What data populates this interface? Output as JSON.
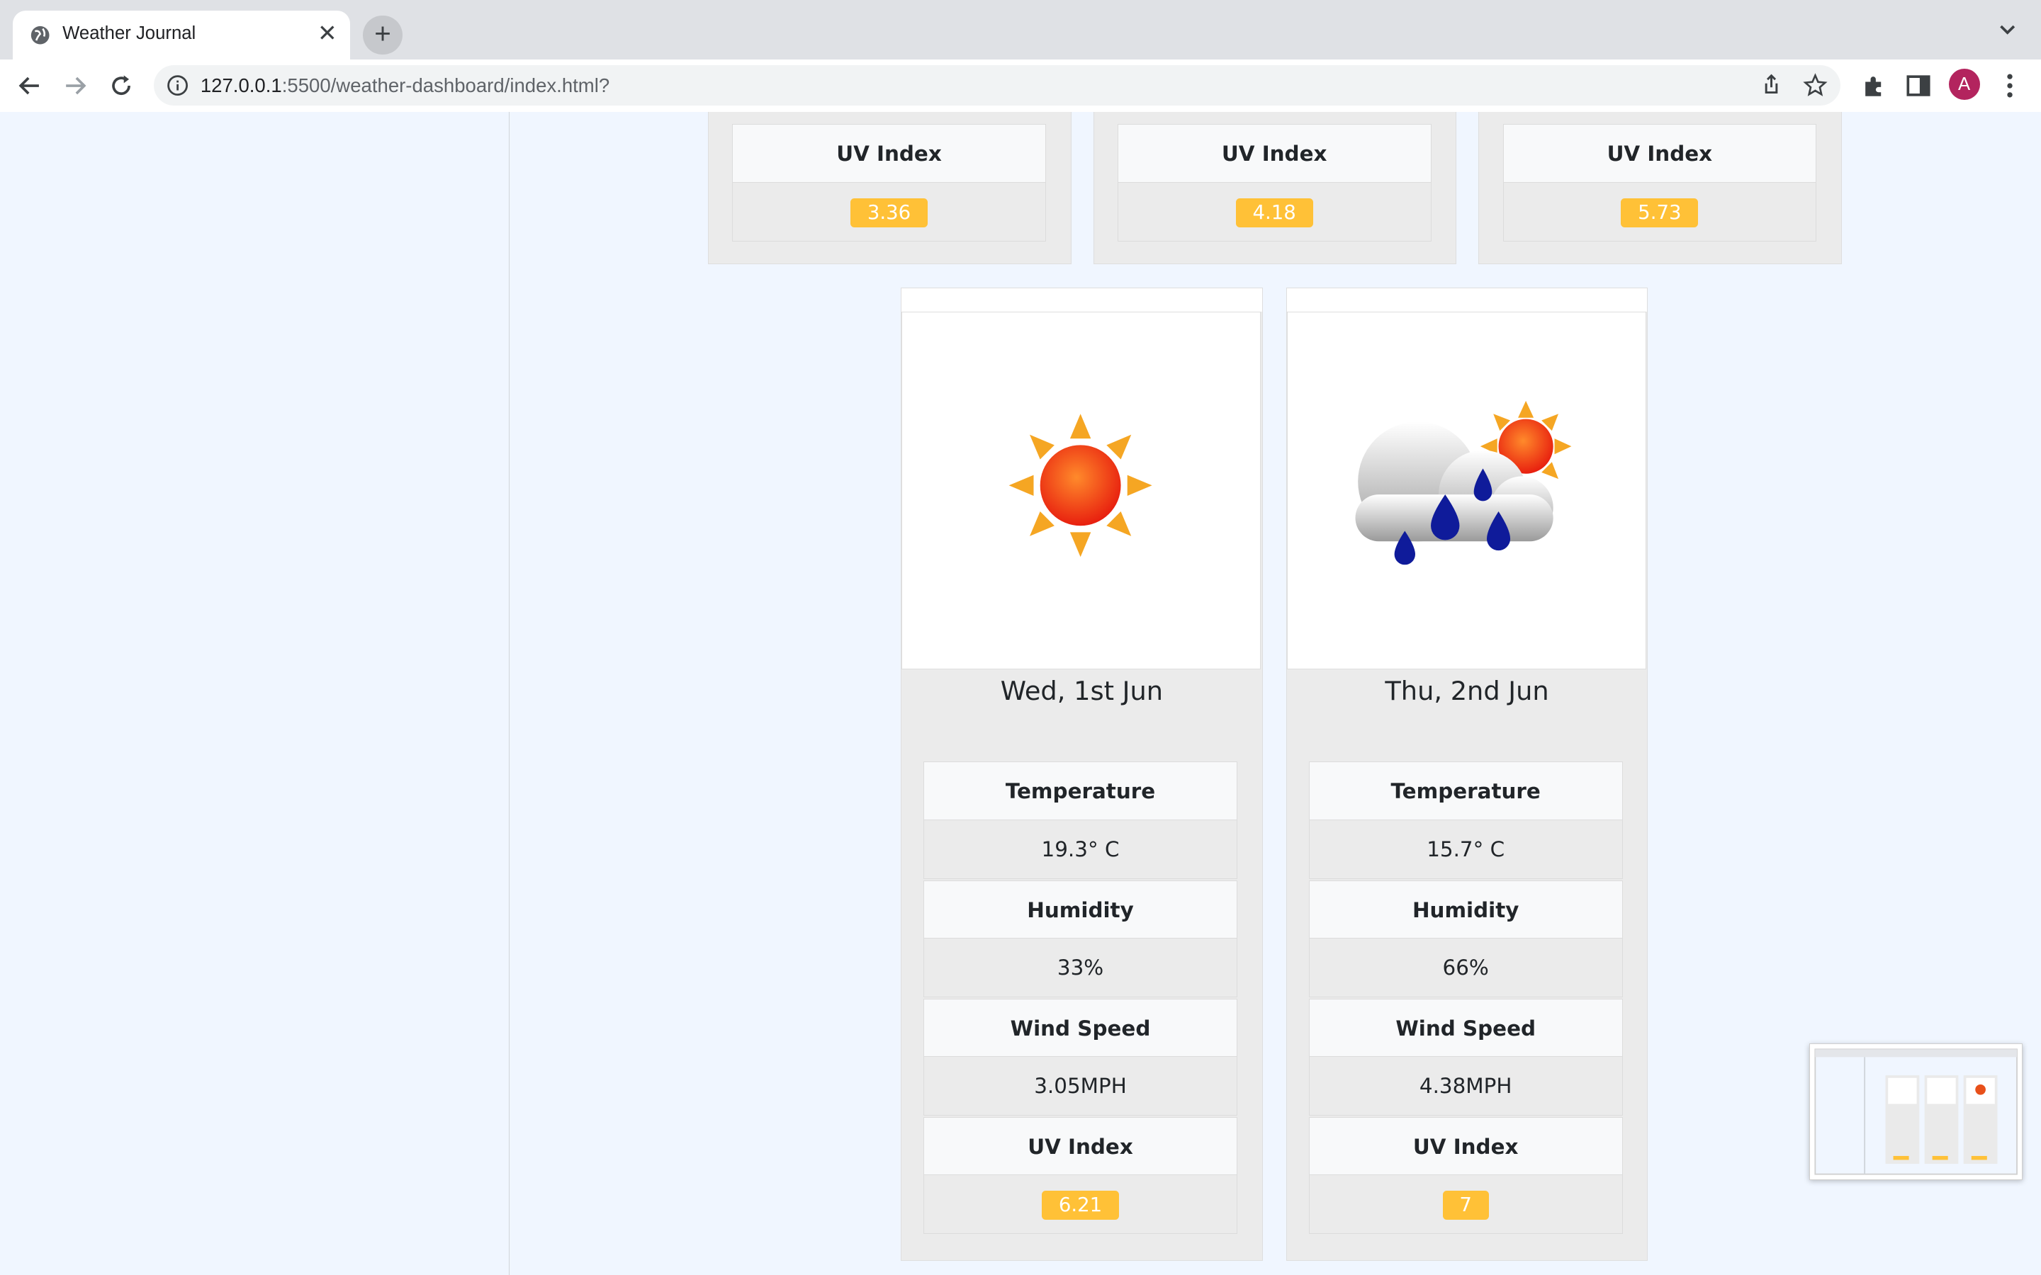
{
  "browser": {
    "tab_title": "Weather Journal",
    "url_host": "127.0.0.1",
    "url_rest": ":5500/weather-dashboard/index.html?",
    "new_tab_label": "+",
    "profile_initial": "A",
    "close_label": "✕"
  },
  "top_row": [
    {
      "uv_label": "UV Index",
      "uv_value": "3.36"
    },
    {
      "uv_label": "UV Index",
      "uv_value": "4.18"
    },
    {
      "uv_label": "UV Index",
      "uv_value": "5.73"
    }
  ],
  "forecast": [
    {
      "icon": "sun-icon",
      "date": "Wed, 1st Jun",
      "temperature_label": "Temperature",
      "temperature": "19.3° C",
      "humidity_label": "Humidity",
      "humidity": "33%",
      "wind_label": "Wind Speed",
      "wind": "3.05MPH",
      "uv_label": "UV Index",
      "uv": "6.21"
    },
    {
      "icon": "rain-cloud-sun-icon",
      "date": "Thu, 2nd Jun",
      "temperature_label": "Temperature",
      "temperature": "15.7° C",
      "humidity_label": "Humidity",
      "humidity": "66%",
      "wind_label": "Wind Speed",
      "wind": "4.38MPH",
      "uv_label": "UV Index",
      "uv": "7"
    }
  ],
  "colors": {
    "uv_badge": "#ffc137",
    "page_bg": "#f0f6ff",
    "card_bg": "#ebebeb"
  }
}
